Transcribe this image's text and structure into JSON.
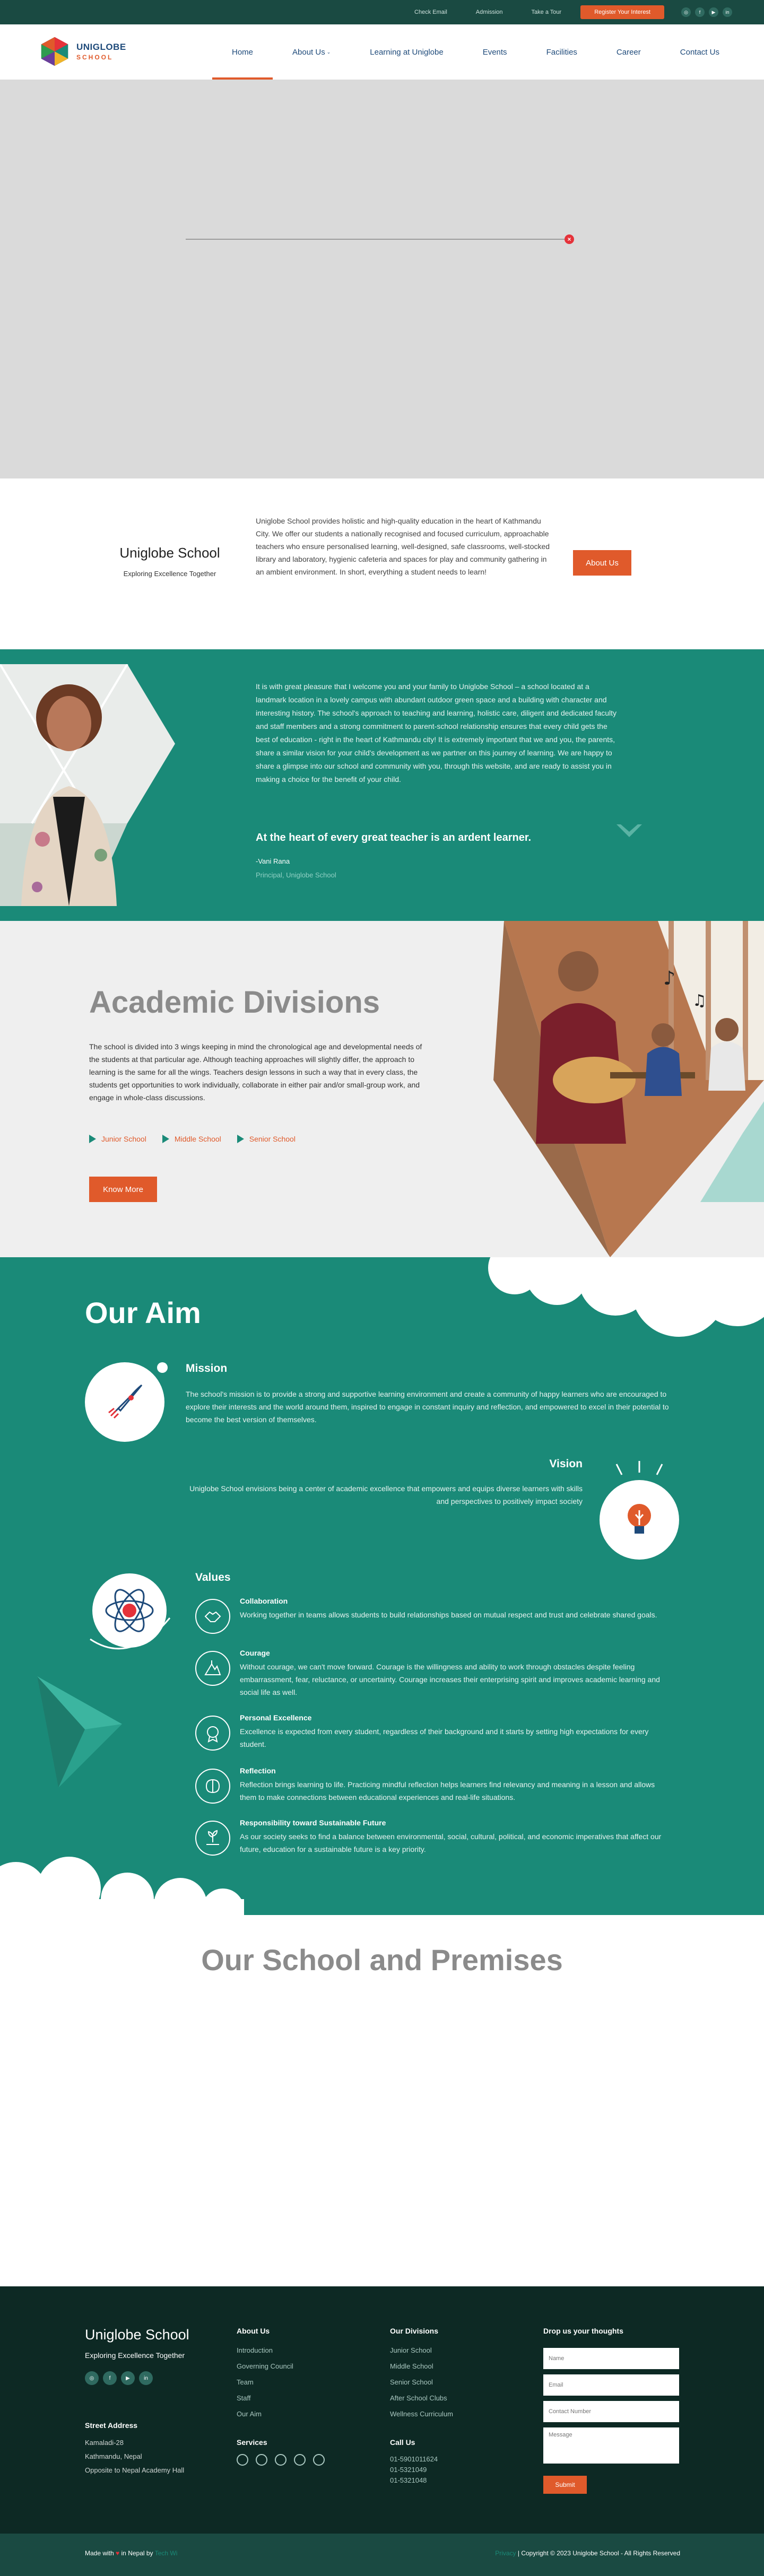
{
  "topbar": {
    "links": [
      "Check Email",
      "Admission",
      "Take a Tour"
    ],
    "cta": "Register Your Interest",
    "social": [
      "instagram-icon",
      "facebook-icon",
      "youtube-icon",
      "linkedin-icon"
    ]
  },
  "header": {
    "logo_title": "UNIGLOBE",
    "logo_sub": "SCHOOL",
    "nav": [
      "Home",
      "About Us",
      "Learning at Uniglobe",
      "Events",
      "Facilities",
      "Career",
      "Contact Us"
    ],
    "active_nav": "Home"
  },
  "intro": {
    "title": "Uniglobe School",
    "subtitle": "Exploring Excellence Together",
    "text": "Uniglobe School provides holistic and high-quality education in the heart of Kathmandu City. We offer our students a nationally recognised and focused curriculum, approachable teachers who ensure personalised learning, well-designed, safe classrooms, well-stocked library and laboratory, hygienic cafeteria and spaces for play and community gathering in an ambient environment. In short, everything a student needs to learn!",
    "button": "About Us"
  },
  "principal": {
    "text": "It is with great pleasure that I welcome you and your family to Uniglobe School – a school located at a landmark location in a lovely campus with abundant outdoor green space and a building with character and interesting history. The school's approach to teaching and learning, holistic care, diligent and dedicated faculty and staff members and a strong commitment to parent-school relationship ensures that every child gets the best of education - right in the heart of Kathmandu city! It is extremely important that we and you, the parents, share a similar vision for your child's development as we partner on this journey of learning. We are happy to share a glimpse into our school and community with you, through this website, and are ready to assist you in making a choice for the benefit of your child.",
    "quote": "At the heart of every great teacher is an ardent learner.",
    "name": "-Vani Rana",
    "role": "Principal, Uniglobe School"
  },
  "academic": {
    "title": "Academic Divisions",
    "text": "The school is divided into 3 wings keeping in mind the chronological age and developmental needs of the students at that particular age. Although teaching approaches will slightly differ, the approach to learning is the same for all the wings. Teachers design lessons in such a way that in every class, the students get opportunities to work individually, collaborate in either pair and/or small-group work, and engage in whole-class discussions.",
    "divisions": [
      "Junior School",
      "Middle School",
      "Senior School"
    ],
    "button": "Know More"
  },
  "aim": {
    "title": "Our Aim",
    "mission_title": "Mission",
    "mission_text": "The school's mission is to provide a strong and supportive learning environment and create a community of happy learners who are encouraged to explore their interests and the world around them, inspired to engage in constant inquiry and reflection, and empowered to excel in their potential to become the best version of themselves.",
    "vision_title": "Vision",
    "vision_text": "Uniglobe School envisions being a center of academic excellence that empowers and equips diverse learners with skills and perspectives to positively impact society",
    "values_title": "Values",
    "values": [
      {
        "title": "Collaboration",
        "text": "Working together in teams allows students to build relationships based on mutual respect and trust and celebrate shared goals."
      },
      {
        "title": "Courage",
        "text": "Without courage, we can't move forward. Courage is the willingness and ability to work through obstacles despite feeling embarrassment, fear, reluctance, or uncertainty. Courage increases their enterprising spirit and improves academic learning and social life as well."
      },
      {
        "title": "Personal Excellence",
        "text": "Excellence is expected from every student, regardless of their background and it starts by setting high expectations for every student."
      },
      {
        "title": "Reflection",
        "text": "Reflection brings learning to life. Practicing mindful reflection helps learners find relevancy and meaning in a lesson and allows them to make connections between educational experiences and real-life situations."
      },
      {
        "title": "Responsibility toward Sustainable Future",
        "text": "As our society seeks to find a balance between environmental, social, cultural, political, and economic imperatives that affect our future, education for a sustainable future is a key priority."
      }
    ]
  },
  "premises": {
    "title": "Our School and Premises"
  },
  "footer": {
    "title": "Uniglobe School",
    "tagline": "Exploring Excellence Together",
    "address_title": "Street Address",
    "address": [
      "Kamaladi-28",
      "Kathmandu, Nepal",
      "Opposite to Nepal Academy Hall"
    ],
    "about_title": "About Us",
    "about_links": [
      "Introduction",
      "Governing Council",
      "Team",
      "Staff",
      "Our Aim"
    ],
    "divisions_title": "Our Divisions",
    "division_links": [
      "Junior School",
      "Middle School",
      "Senior School",
      "After School Clubs",
      "Wellness Curriculum"
    ],
    "services_title": "Services",
    "call_title": "Call Us",
    "phones": [
      "01-5901011624",
      "01-5321049",
      "01-5321048"
    ],
    "form_title": "Drop us your thoughts",
    "form_placeholders": {
      "name": "Name",
      "email": "Email",
      "contact": "Contact Number",
      "message": "Message"
    },
    "submit": "Submit"
  },
  "bottom": {
    "made_with": "Made with",
    "in_nepal": "in Nepal by",
    "agency": "Tech Wi",
    "privacy": "Privacy",
    "copyright": "| Copyright © 2023 Uniglobe School - All Rights Reserved"
  },
  "colors": {
    "teal": "#1a8a78",
    "dark": "#1a4a42",
    "orange": "#e05a2b",
    "navy": "#1e4a7a"
  }
}
